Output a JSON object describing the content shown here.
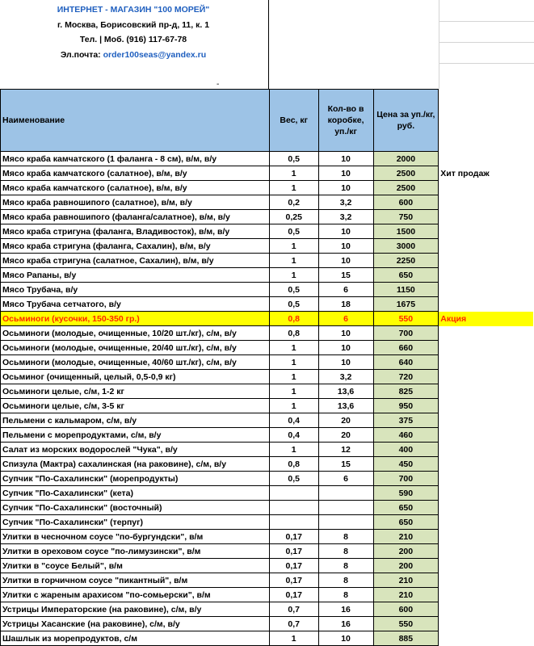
{
  "shop": {
    "title": "ИНТЕРНЕТ - МАГАЗИН \"100 МОРЕЙ\"",
    "address": "г. Москва, Борисовский пр-д, 11, к. 1",
    "phone": "Тел.   | Моб. (916) 117-67-78",
    "email_label": "Эл.почта:",
    "email": "order100seas@yandex.ru",
    "dash": "-"
  },
  "columns": {
    "name": "Наименование",
    "weight": "Вес, кг",
    "qty": "Кол-во в коробке, уп./кг",
    "price": "Цена за уп./кг, руб."
  },
  "rows": [
    {
      "name": "Мясо краба камчатского (1 фаланга - 8 см), в/м, в/у",
      "weight": "0,5",
      "qty": "10",
      "price": "2000",
      "note": ""
    },
    {
      "name": "Мясо краба камчатского (салатное), в/м, в/у",
      "weight": "1",
      "qty": "10",
      "price": "2500",
      "note": "Хит продаж"
    },
    {
      "name": "Мясо краба камчатского (салатное), в/м, в/у",
      "weight": "1",
      "qty": "10",
      "price": "2500",
      "note": ""
    },
    {
      "name": "Мясо краба равношипого (салатное), в/м, в/у",
      "weight": "0,2",
      "qty": "3,2",
      "price": "600",
      "note": ""
    },
    {
      "name": "Мясо краба равношипого (фаланга/салатное), в/м, в/у",
      "weight": "0,25",
      "qty": "3,2",
      "price": "750",
      "note": ""
    },
    {
      "name": "Мясо краба стригуна (фаланга, Владивосток), в/м, в/у",
      "weight": "0,5",
      "qty": "10",
      "price": "1500",
      "note": ""
    },
    {
      "name": "Мясо краба стригуна (фаланга, Сахалин), в/м, в/у",
      "weight": "1",
      "qty": "10",
      "price": "3000",
      "note": ""
    },
    {
      "name": "Мясо краба стригуна (салатное, Сахалин), в/м, в/у",
      "weight": "1",
      "qty": "10",
      "price": "2250",
      "note": ""
    },
    {
      "name": "Мясо Рапаны, в/у",
      "weight": "1",
      "qty": "15",
      "price": "650",
      "note": ""
    },
    {
      "name": "Мясо Трубача, в/у",
      "weight": "0,5",
      "qty": "6",
      "price": "1150",
      "note": ""
    },
    {
      "name": "Мясо Трубача сетчатого, в/у",
      "weight": "0,5",
      "qty": "18",
      "price": "1675",
      "note": ""
    },
    {
      "name": "Осьминоги (кусочки, 150-350 гр.)",
      "weight": "0,8",
      "qty": "6",
      "price": "550",
      "note": "Акция",
      "promo": true
    },
    {
      "name": "Осьминоги (молодые, очищенные, 10/20 шт./кг), с/м, в/у",
      "weight": "0,8",
      "qty": "10",
      "price": "700",
      "note": ""
    },
    {
      "name": "Осьминоги (молодые, очищенные, 20/40 шт./кг), с/м, в/у",
      "weight": "1",
      "qty": "10",
      "price": "660",
      "note": ""
    },
    {
      "name": "Осьминоги (молодые, очищенные, 40/60 шт./кг), с/м, в/у",
      "weight": "1",
      "qty": "10",
      "price": "640",
      "note": ""
    },
    {
      "name": "Осьминог (очищенный, целый, 0,5-0,9 кг)",
      "weight": "1",
      "qty": "3,2",
      "price": "720",
      "note": ""
    },
    {
      "name": "Осьминоги целые, с/м, 1-2 кг",
      "weight": "1",
      "qty": "13,6",
      "price": "825",
      "note": ""
    },
    {
      "name": "Осьминоги целые, с/м, 3-5 кг",
      "weight": "1",
      "qty": "13,6",
      "price": "950",
      "note": ""
    },
    {
      "name": "Пельмени с кальмаром, с/м, в/у",
      "weight": "0,4",
      "qty": "20",
      "price": "375",
      "note": ""
    },
    {
      "name": "Пельмени с морепродуктами, с/м, в/у",
      "weight": "0,4",
      "qty": "20",
      "price": "460",
      "note": ""
    },
    {
      "name": "Салат из морских водорослей \"Чука\", в/у",
      "weight": "1",
      "qty": "12",
      "price": "400",
      "note": ""
    },
    {
      "name": "Спизула (Мактра) сахалинская (на раковине), с/м, в/у",
      "weight": "0,8",
      "qty": "15",
      "price": "450",
      "note": ""
    },
    {
      "name": "Супчик \"По-Сахалински\" (морепродукты)",
      "weight": "0,5",
      "qty": "6",
      "price": "700",
      "note": ""
    },
    {
      "name": "Супчик \"По-Сахалински\" (кета)",
      "weight": "",
      "qty": "",
      "price": "590",
      "note": ""
    },
    {
      "name": "Супчик \"По-Сахалински\" (восточный)",
      "weight": "",
      "qty": "",
      "price": "650",
      "note": ""
    },
    {
      "name": "Супчик \"По-Сахалински\" (терпуг)",
      "weight": "",
      "qty": "",
      "price": "650",
      "note": ""
    },
    {
      "name": "Улитки в чесночном соусе \"по-бургундски\", в/м",
      "weight": "0,17",
      "qty": "8",
      "price": "210",
      "note": ""
    },
    {
      "name": "Улитки в ореховом соусе \"по-лимузински\", в/м",
      "weight": "0,17",
      "qty": "8",
      "price": "200",
      "note": ""
    },
    {
      "name": "Улитки в \"соусе Белый\", в/м",
      "weight": "0,17",
      "qty": "8",
      "price": "200",
      "note": ""
    },
    {
      "name": "Улитки в горчичном соусе \"пикантный\", в/м",
      "weight": "0,17",
      "qty": "8",
      "price": "210",
      "note": ""
    },
    {
      "name": "Улитки с жареным арахисом \"по-сомьерски\", в/м",
      "weight": "0,17",
      "qty": "8",
      "price": "210",
      "note": ""
    },
    {
      "name": "Устрицы Императорские (на раковине), с/м, в/у",
      "weight": "0,7",
      "qty": "16",
      "price": "600",
      "note": ""
    },
    {
      "name": "Устрицы Хасанские (на раковине), с/м, в/у",
      "weight": "0,7",
      "qty": "16",
      "price": "550",
      "note": ""
    },
    {
      "name": "Шашлык из морепродуктов, с/м",
      "weight": "1",
      "qty": "10",
      "price": "885",
      "note": ""
    }
  ]
}
